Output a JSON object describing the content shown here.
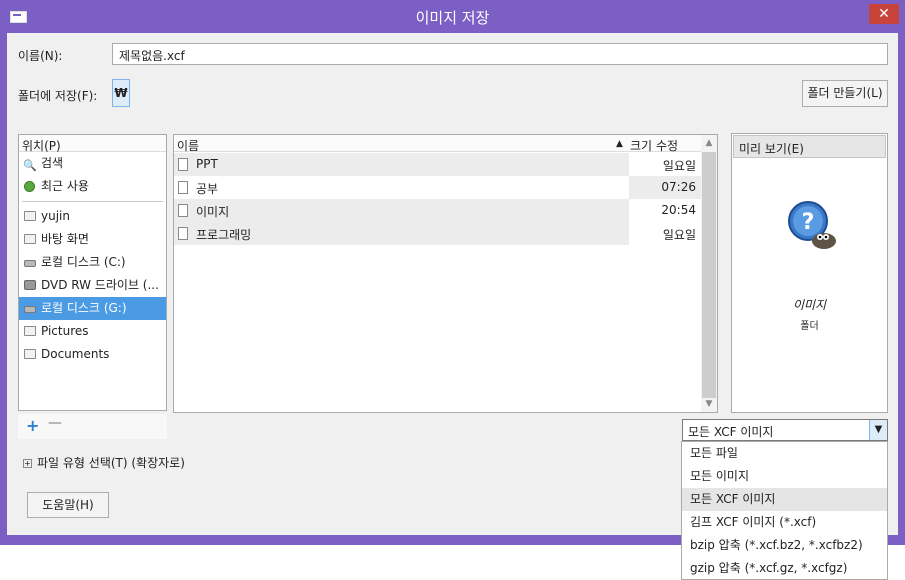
{
  "window": {
    "title": "이미지 저장",
    "close_label": "✕"
  },
  "name_row": {
    "label": "이름(N):",
    "value": "제목없음.xcf"
  },
  "folder_row": {
    "label": "폴더에 저장(F):",
    "folder_button": "₩",
    "create_folder_label": "폴더 만들기(L)"
  },
  "places": {
    "header": "위치(P)",
    "items": [
      {
        "label": "검색",
        "icon": "search-icon"
      },
      {
        "label": "최근 사용",
        "icon": "recent-icon"
      },
      {
        "label": "yujin",
        "icon": "folder-icon"
      },
      {
        "label": "바탕 화면",
        "icon": "folder-icon"
      },
      {
        "label": "로컬 디스크 (C:)",
        "icon": "drive-icon"
      },
      {
        "label": "DVD RW 드라이브 (...",
        "icon": "dvd-icon"
      },
      {
        "label": "로컬 디스크 (G:)",
        "icon": "drive-icon",
        "selected": true
      },
      {
        "label": "Pictures",
        "icon": "folder-icon"
      },
      {
        "label": "Documents",
        "icon": "folder-icon"
      }
    ],
    "add_label": "+",
    "remove_label": "—"
  },
  "files": {
    "columns": {
      "name": "이름",
      "sort_indicator": "▲",
      "size": "크기",
      "modified": "수정"
    },
    "rows": [
      {
        "name": "PPT",
        "date": "일요일"
      },
      {
        "name": "공부",
        "date": "07:26"
      },
      {
        "name": "이미지",
        "date": "20:54"
      },
      {
        "name": "프로그래밍",
        "date": "일요일"
      }
    ]
  },
  "preview": {
    "header": "미리 보기(E)",
    "caption": "이미지",
    "subcaption": "폴더"
  },
  "filetype": {
    "selected": "모든 XCF 이미지",
    "options": [
      "모든 파일",
      "모든 이미지",
      "모든 XCF 이미지",
      "김프 XCF 이미지 (*.xcf)",
      "bzip 압축 (*.xcf.bz2, *.xcfbz2)",
      "gzip 압축 (*.xcf.gz, *.xcfgz)"
    ]
  },
  "expander": {
    "label": "파일 유형 선택(T) (확장자로)"
  },
  "help": {
    "label": "도움말(H)"
  }
}
